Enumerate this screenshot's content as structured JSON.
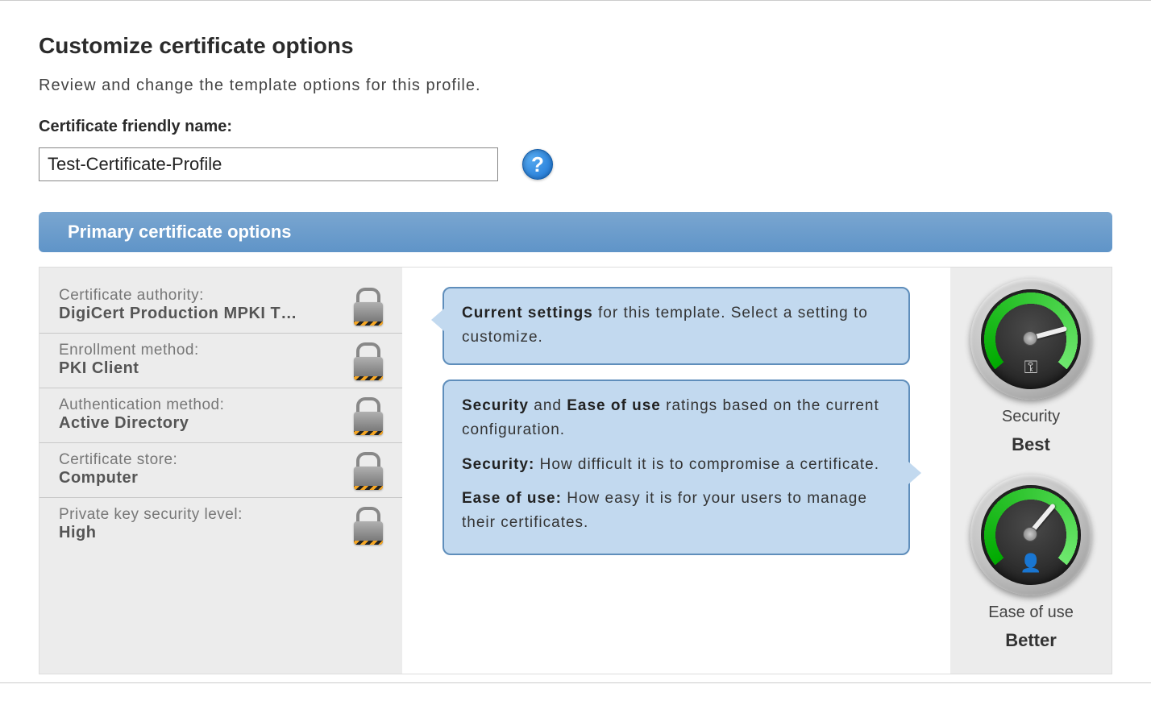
{
  "header": {
    "title": "Customize certificate options",
    "subtitle": "Review and change the template options for this profile.",
    "friendlyNameLabel": "Certificate friendly name:",
    "friendlyNameValue": "Test-Certificate-Profile",
    "helpIcon": "?"
  },
  "section": {
    "title": "Primary certificate options"
  },
  "options": {
    "certAuthority": {
      "label": "Certificate authority:",
      "value": "DigiCert Production MPKI T…"
    },
    "enrollment": {
      "label": "Enrollment method:",
      "value": "PKI Client"
    },
    "auth": {
      "label": "Authentication method:",
      "value": "Active Directory"
    },
    "store": {
      "label": "Certificate store:",
      "value": "Computer"
    },
    "keySecurity": {
      "label": "Private key security level:",
      "value": "High"
    }
  },
  "callouts": {
    "c1_bold": "Current settings",
    "c1_rest": " for this template. Select a setting to customize.",
    "c2_p1_a": "Security",
    "c2_p1_mid": " and ",
    "c2_p1_b": "Ease of use",
    "c2_p1_rest": " ratings based on the current configuration.",
    "c2_p2_bold": "Security:",
    "c2_p2_rest": " How difficult it is to compromise a certificate.",
    "c2_p3_bold": "Ease of use:",
    "c2_p3_rest": " How easy it is for your users to manage their certificates."
  },
  "gauges": {
    "security": {
      "label": "Security",
      "rating": "Best",
      "glyph": "⚿"
    },
    "ease": {
      "label": "Ease of use",
      "rating": "Better",
      "glyph": "👤"
    }
  }
}
